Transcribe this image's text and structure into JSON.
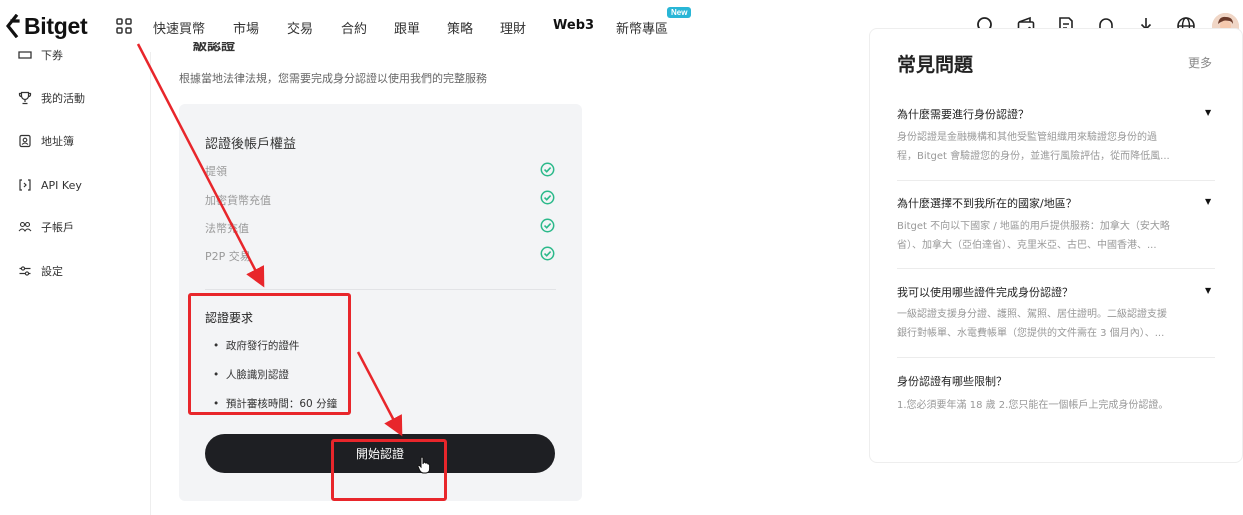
{
  "topbar": {
    "brand": "Bitget",
    "nav": [
      {
        "label": "快速買幣",
        "bold": false
      },
      {
        "label": "市場",
        "bold": false
      },
      {
        "label": "交易",
        "bold": false
      },
      {
        "label": "合約",
        "bold": false
      },
      {
        "label": "跟單",
        "bold": false
      },
      {
        "label": "策略",
        "bold": false
      },
      {
        "label": "理財",
        "bold": false
      },
      {
        "label": "Web3",
        "bold": true
      },
      {
        "label": "新幣專區",
        "bold": false
      }
    ],
    "new_badge": "New",
    "icons": [
      "search-icon",
      "wallet-icon",
      "orders-icon",
      "bell-icon",
      "download-icon",
      "globe-icon"
    ]
  },
  "sidebar": {
    "items": [
      {
        "label": "下券",
        "icon": "coupon-icon"
      },
      {
        "label": "我的活動",
        "icon": "trophy-icon"
      },
      {
        "label": "地址簿",
        "icon": "address-book-icon"
      },
      {
        "label": "API Key",
        "icon": "api-icon"
      },
      {
        "label": "子帳戶",
        "icon": "sub-account-icon"
      },
      {
        "label": "設定",
        "icon": "settings-icon"
      }
    ]
  },
  "main": {
    "section_title": "級認證",
    "subtitle": "根據當地法律法規，您需要完成身分認證以使用我們的完整服務",
    "benefits_heading": "認證後帳戶權益",
    "benefits": [
      "提領",
      "加密貨幣充值",
      "法幣充值",
      "P2P 交易"
    ],
    "requirements_heading": "認證要求",
    "requirements": [
      "政府發行的證件",
      "人臉識別認證",
      "預計審核時間：60 分鐘"
    ],
    "start_button": "開始認證"
  },
  "faq": {
    "title": "常見問題",
    "more": "更多",
    "items": [
      {
        "q": "為什麼需要進行身份認證？",
        "a": [
          "身份認證是金融機構和其他受監管組織用來驗證您身份的過",
          "程，Bitget 會驗證您的身份，並進行風險評估，從而降低風..."
        ]
      },
      {
        "q": "為什麼選擇不到我所在的國家/地區？",
        "a": [
          "Bitget 不向以下國家 / 地區的用戶提供服務：加拿大（安大略",
          "省）、加拿大（亞伯達省）、克里米亞、古巴、中國香港、..."
        ]
      },
      {
        "q": "我可以使用哪些證件完成身份認證？",
        "a": [
          "一級認證支援身分證、護照、駕照、居住證明。二級認證支援",
          "銀行對帳單、水電費帳單（您提供的文件需在 3 個月內）、..."
        ]
      },
      {
        "q": "身份認證有哪些限制？",
        "a": [
          "1.您必須要年滿 18 歲 2.您只能在一個帳戶上完成身份認證。"
        ]
      }
    ]
  },
  "colors": {
    "accent_green": "#2bb98a",
    "annotation_red": "#e8262b",
    "button_dark": "#1e1f23"
  }
}
